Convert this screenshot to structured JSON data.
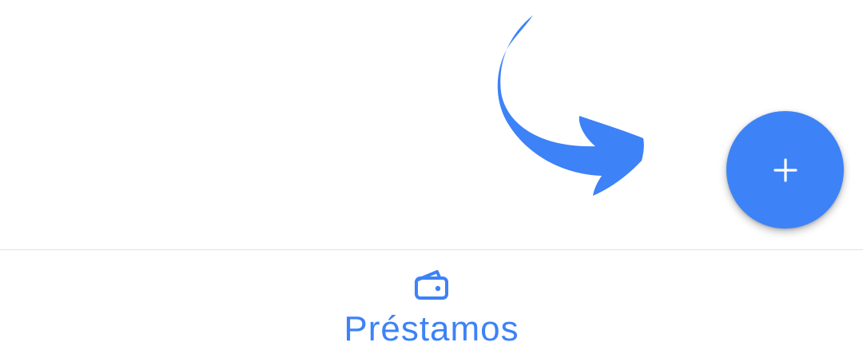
{
  "colors": {
    "accent": "#3d82f7",
    "background": "#ffffff",
    "divider": "#e2e2e2",
    "fab_icon": "#ffffff"
  },
  "hint": {
    "icon": "curved-arrow-icon"
  },
  "fab": {
    "icon": "plus-icon"
  },
  "bottom_nav": {
    "items": [
      {
        "label": "Préstamos",
        "icon": "wallet-icon",
        "active": true
      }
    ]
  }
}
